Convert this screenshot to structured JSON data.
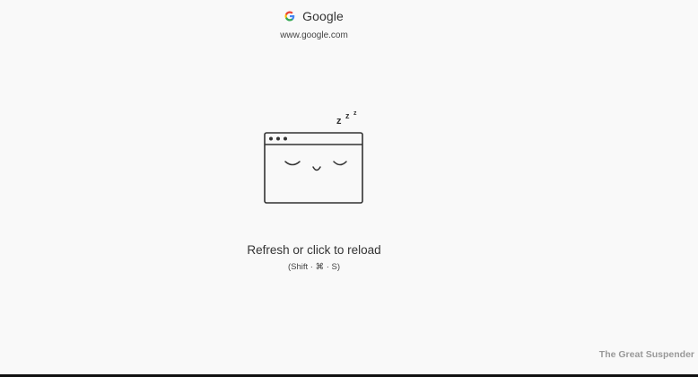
{
  "site": {
    "title": "Google",
    "url": "www.google.com",
    "favicon_icon": "google-g-icon"
  },
  "illustration": {
    "icon": "sleeping-browser-window-icon",
    "snore_text": "z z z"
  },
  "message": {
    "reload": "Refresh or click to reload",
    "shortcut": "(Shift · ⌘ · S)"
  },
  "footer": {
    "brand": "The Great Suspender"
  },
  "colors": {
    "background": "#f9f9f9",
    "text": "#333333",
    "brand": "#999999",
    "google_blue": "#4285F4",
    "google_red": "#EA4335",
    "google_yellow": "#FBBC05",
    "google_green": "#34A853"
  }
}
